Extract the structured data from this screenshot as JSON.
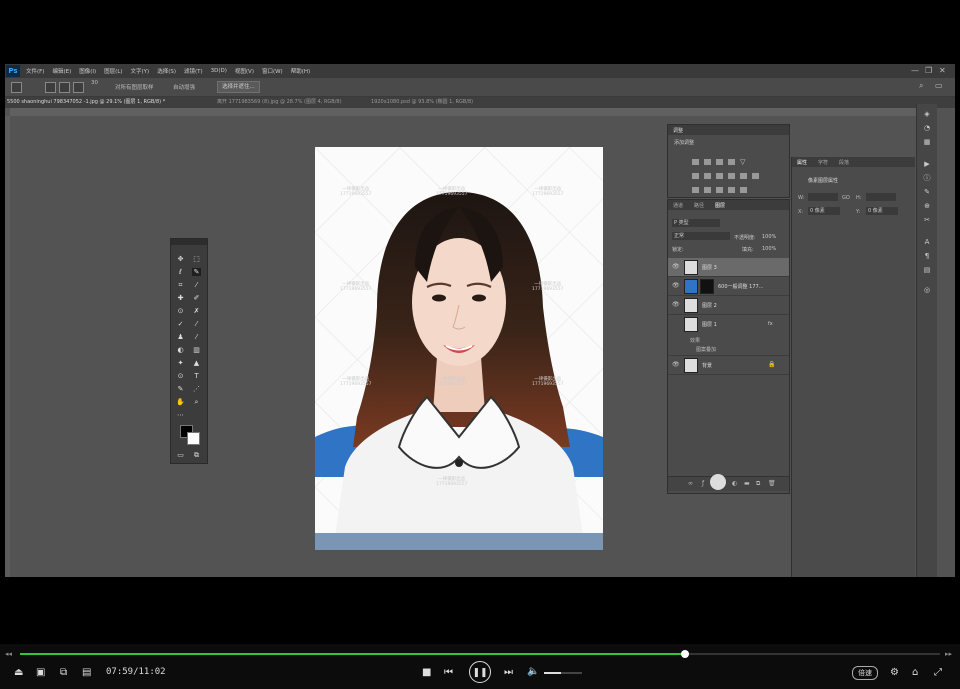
{
  "app": {
    "logo": "Ps",
    "menu": [
      "文件(F)",
      "编辑(E)",
      "图像(I)",
      "图层(L)",
      "文字(Y)",
      "选择(S)",
      "滤镜(T)",
      "3D(D)",
      "视图(V)",
      "窗口(W)",
      "帮助(H)"
    ],
    "window_controls": [
      "—",
      "❐",
      "✕"
    ]
  },
  "options_bar": {
    "brush_size": "30",
    "sample_all_layers": "对所有图层取样",
    "auto_enhance": "自动增强",
    "select_subject": "选择并遮住..."
  },
  "doc_tabs": [
    {
      "label": "5500  shaoninghui  798347052  -1.jpg @ 29.1% (图层 1, RGB/8) *",
      "active": true
    },
    {
      "label": "离开 1771983569 (8).jpg @ 28.7% (图层 4, RGB/8)",
      "active": false
    },
    {
      "label": "1920x1080.psd @ 93.8% (椭圆 1, RGB/8)",
      "active": false
    }
  ],
  "watermarks": [
    {
      "line1": "一律摄影出品",
      "line2": "17719693557"
    },
    {
      "line1": "一律摄影出品",
      "line2": "17719693557"
    },
    {
      "line1": "一律摄影出品",
      "line2": "17719693557"
    },
    {
      "line1": "一律摄影出品",
      "line2": "17719693557"
    },
    {
      "line1": "一律摄影出品",
      "line2": "17719693557"
    },
    {
      "line1": "一律摄影出品",
      "line2": "17719693557"
    },
    {
      "line1": "一律摄影出品",
      "line2": "17719693557"
    },
    {
      "line1": "一律摄影出品",
      "line2": "17719693557"
    },
    {
      "line1": "一律摄影出品",
      "line2": "17719693557"
    }
  ],
  "adjustments_panel": {
    "tab": "调整",
    "add_label": "添加调整"
  },
  "layers_panel": {
    "tabs": [
      "通道",
      "路径",
      "图层"
    ],
    "filter_kind": "P 类型",
    "blend_mode": "正常",
    "opacity_label": "不透明度:",
    "opacity_value": "100%",
    "lock_label": "锁定:",
    "fill_label": "填充:",
    "fill_value": "100%",
    "layers": [
      {
        "name": "图层 3",
        "selected": true,
        "fx": ""
      },
      {
        "name": "600一般调整 177...",
        "selected": false,
        "fx": ""
      },
      {
        "name": "图层 2",
        "selected": false,
        "fx": ""
      },
      {
        "name": "图层 1",
        "selected": false,
        "fx": "fx"
      },
      {
        "name": "背景",
        "selected": false,
        "fx": ""
      }
    ],
    "effects_label": "效果",
    "effect_item": "图案叠加"
  },
  "properties_panel": {
    "tabs": [
      "属性",
      "字符",
      "段落"
    ],
    "title": "像素图层属性",
    "w_label": "W:",
    "h_label": "H:",
    "x_label": "X:",
    "x_value": "0 像素",
    "y_label": "Y:",
    "y_value": "0 像素",
    "go_label": "GO"
  },
  "player": {
    "current_time": "07:59",
    "total_time": "11:02",
    "time_display": "07:59/11:02",
    "progress": 0.723,
    "volume": 0.45,
    "speed_label": "倍速"
  },
  "colors": {
    "ps_bg": "#535353",
    "seek_fill": "#32c832",
    "shirt_blue": "#2f74c5"
  }
}
